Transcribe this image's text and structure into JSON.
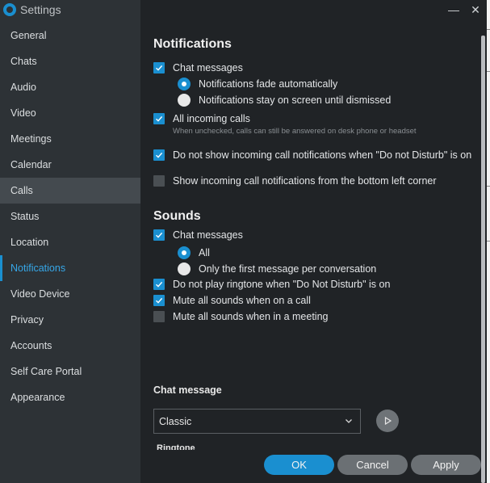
{
  "window": {
    "title": "Settings",
    "controls": {
      "minimize_icon": "minimize-icon",
      "close_icon": "close-icon",
      "minimize": "—",
      "close": "✕"
    }
  },
  "sidebar": {
    "items": [
      {
        "label": "General"
      },
      {
        "label": "Chats"
      },
      {
        "label": "Audio"
      },
      {
        "label": "Video"
      },
      {
        "label": "Meetings"
      },
      {
        "label": "Calendar"
      },
      {
        "label": "Calls",
        "state": "hover"
      },
      {
        "label": "Status"
      },
      {
        "label": "Location"
      },
      {
        "label": "Notifications",
        "state": "active"
      },
      {
        "label": "Video Device"
      },
      {
        "label": "Privacy"
      },
      {
        "label": "Accounts"
      },
      {
        "label": "Self Care Portal"
      },
      {
        "label": "Appearance"
      }
    ]
  },
  "notifications": {
    "title": "Notifications",
    "chat_messages": {
      "label": "Chat messages",
      "checked": true
    },
    "fade_radio": {
      "label": "Notifications fade automatically",
      "selected": true
    },
    "stay_radio": {
      "label": "Notifications stay on screen until dismissed",
      "selected": false
    },
    "all_incoming_calls": {
      "label": "All incoming calls",
      "checked": true
    },
    "incoming_hint": "When unchecked, calls can still be answered on desk phone or headset",
    "dnd_calls": {
      "label": "Do not show incoming call notifications when \"Do not Disturb\" is on",
      "checked": true
    },
    "bottom_left": {
      "label": "Show incoming call notifications from the bottom left corner",
      "checked": false
    }
  },
  "sounds": {
    "title": "Sounds",
    "chat_messages": {
      "label": "Chat messages",
      "checked": true
    },
    "all_radio": {
      "label": "All",
      "selected": true
    },
    "first_radio": {
      "label": "Only the first message per conversation",
      "selected": false
    },
    "dnd_ringtone": {
      "label": "Do not play ringtone when \"Do Not Disturb\" is on",
      "checked": true
    },
    "mute_on_call": {
      "label": "Mute all sounds when on a call",
      "checked": true
    },
    "mute_in_meeting": {
      "label": "Mute all sounds when in a meeting",
      "checked": false
    }
  },
  "chat_message_sound": {
    "heading": "Chat message",
    "selected": "Classic",
    "play_icon": "play-icon"
  },
  "ringtone": {
    "heading": "Ringtone"
  },
  "footer": {
    "ok": "OK",
    "cancel": "Cancel",
    "apply": "Apply"
  },
  "colors": {
    "accent": "#1a8fd0",
    "sidebar_bg": "#2d3236",
    "content_bg": "#202326"
  }
}
